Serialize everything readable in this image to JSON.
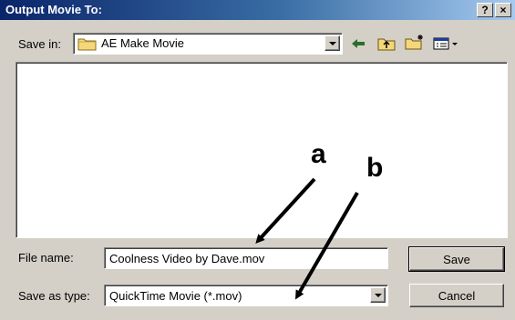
{
  "dialog": {
    "title": "Output Movie To:",
    "help_button": "?",
    "close_button": "×"
  },
  "toolbar": {
    "save_in_label": "Save in:",
    "save_in_value": "AE Make Movie",
    "icons": [
      "back-icon",
      "up-folder-icon",
      "new-folder-icon",
      "view-menu-icon"
    ]
  },
  "fields": {
    "file_name_label": "File name:",
    "file_name_value": "Coolness Video by Dave.mov",
    "save_as_type_label": "Save as type:",
    "save_as_type_value": "QuickTime Movie (*.mov)"
  },
  "buttons": {
    "save": "Save",
    "cancel": "Cancel"
  },
  "annotations": {
    "a": "a",
    "b": "b"
  },
  "colors": {
    "titlebar_start": "#0a246a",
    "titlebar_end": "#a6caf0",
    "folder_yellow": "#f5d77a",
    "icon_accent": "#2b6d2b"
  }
}
